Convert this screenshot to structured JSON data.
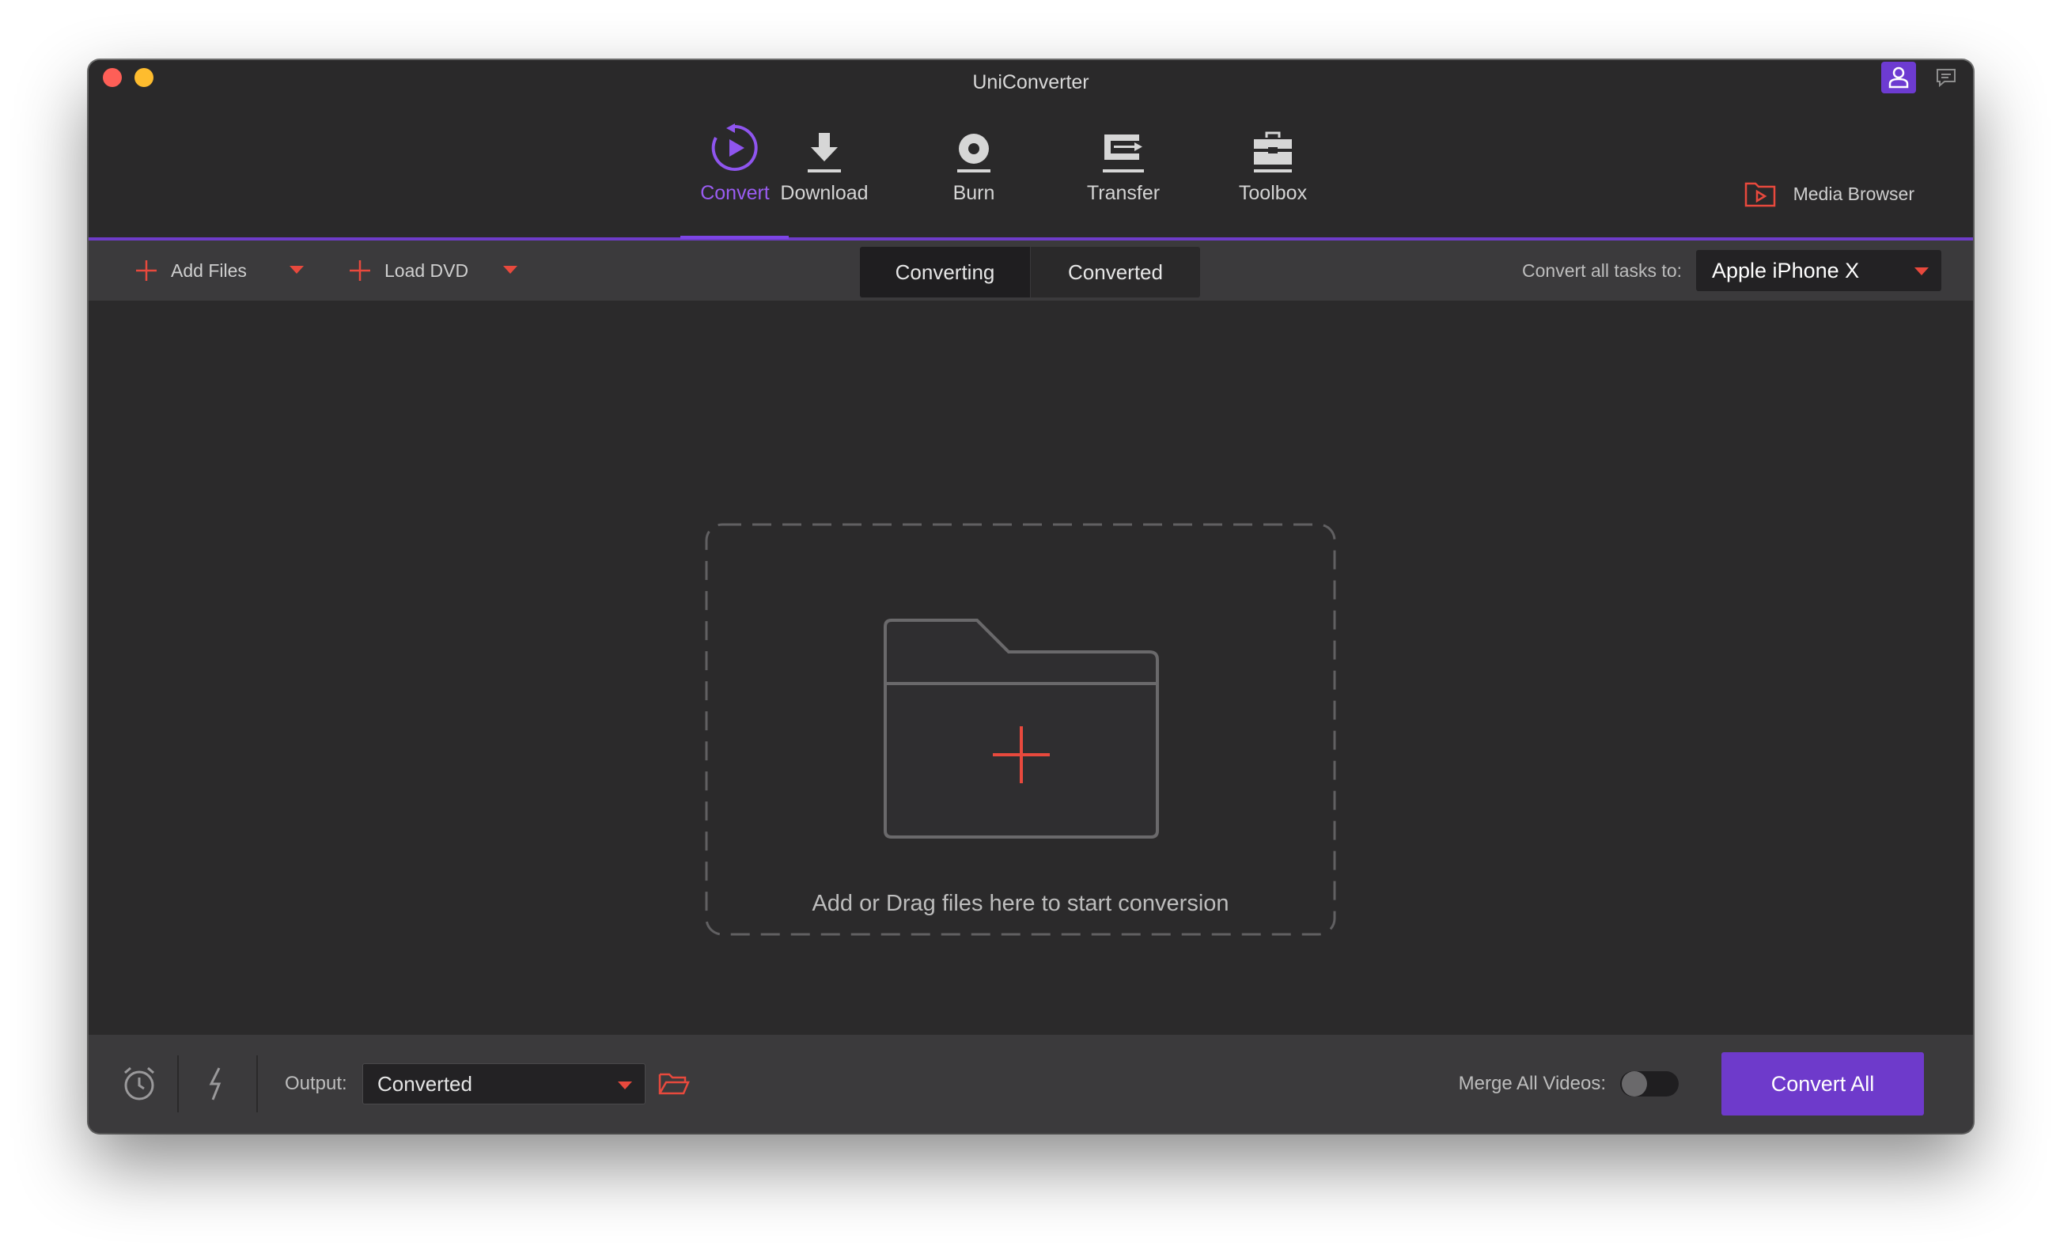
{
  "window": {
    "title": "UniConverter"
  },
  "nav": {
    "items": [
      {
        "label": "Convert",
        "icon": "convert-icon",
        "active": true
      },
      {
        "label": "Download",
        "icon": "download-icon",
        "active": false
      },
      {
        "label": "Burn",
        "icon": "burn-icon",
        "active": false
      },
      {
        "label": "Transfer",
        "icon": "transfer-icon",
        "active": false
      },
      {
        "label": "Toolbox",
        "icon": "toolbox-icon",
        "active": false
      }
    ],
    "media_browser": "Media Browser"
  },
  "toolbar": {
    "add_files": "Add Files",
    "load_dvd": "Load DVD",
    "tabs": [
      "Converting",
      "Converted"
    ],
    "active_tab": "Converting",
    "convert_all_label": "Convert all tasks to:",
    "preset_value": "Apple iPhone X"
  },
  "main": {
    "drop_text": "Add or Drag files here to start conversion"
  },
  "bottom": {
    "output_label": "Output:",
    "output_value": "Converted",
    "merge_label": "Merge All Videos:",
    "merge_enabled": false,
    "convert_all_button": "Convert All"
  },
  "colors": {
    "accent_purple": "#6e3acb",
    "nav_active": "#9a5cf2",
    "accent_red": "#e8493d",
    "background": "#2b2a2b",
    "toolbar": "#3b3a3c"
  }
}
